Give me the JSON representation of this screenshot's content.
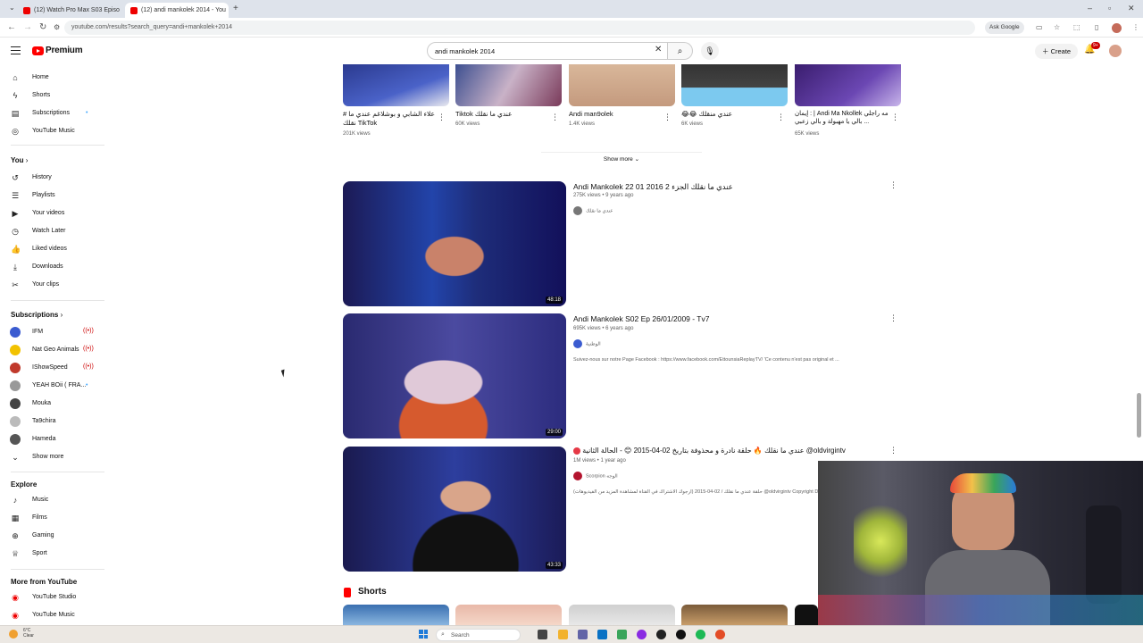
{
  "browser": {
    "tabs": [
      {
        "title": "(12) Watch Pro Max S03 Episo"
      },
      {
        "title": "(12) andi mankolek 2014 - You"
      }
    ],
    "url": "youtube.com/results?search_query=andi+mankolek+2014",
    "ask_google": "Ask Google"
  },
  "header": {
    "logo": "Premium",
    "search_value": "andi mankolek 2014",
    "create_label": "Create",
    "notif_count": "9+"
  },
  "sidebar": {
    "main": [
      {
        "label": "Home",
        "icon": "home-icon"
      },
      {
        "label": "Shorts",
        "icon": "shorts-icon"
      },
      {
        "label": "Subscriptions",
        "icon": "subscriptions-icon"
      },
      {
        "label": "YouTube Music",
        "icon": "music-icon"
      }
    ],
    "you_label": "You",
    "you": [
      {
        "label": "History"
      },
      {
        "label": "Playlists"
      },
      {
        "label": "Your videos"
      },
      {
        "label": "Watch Later"
      },
      {
        "label": "Liked videos"
      },
      {
        "label": "Downloads"
      },
      {
        "label": "Your clips"
      }
    ],
    "subs_label": "Subscriptions",
    "subs": [
      {
        "label": "IFM",
        "color": "#3a5bd0",
        "state": "live"
      },
      {
        "label": "Nat Geo Animals",
        "color": "#f2c200",
        "state": "live"
      },
      {
        "label": "IShowSpeed",
        "color": "#c0392b",
        "state": "live"
      },
      {
        "label": "YEAH BOii ( FRA...",
        "color": "#999999",
        "state": "dot"
      },
      {
        "label": "Mouka",
        "color": "#444444",
        "state": ""
      },
      {
        "label": "Ta9chira",
        "color": "#bbbbbb",
        "state": ""
      },
      {
        "label": "Hameda",
        "color": "#555555",
        "state": ""
      }
    ],
    "show_more": "Show more",
    "explore_label": "Explore",
    "explore": [
      {
        "label": "Music"
      },
      {
        "label": "Films"
      },
      {
        "label": "Gaming"
      },
      {
        "label": "Sport"
      }
    ],
    "more_label": "More from YouTube",
    "more": [
      {
        "label": "YouTube Studio"
      },
      {
        "label": "YouTube Music"
      }
    ]
  },
  "top_row": [
    {
      "title": "# علاء الشابي و بوشلاغم عندي ما نقلك TikTok",
      "views": "201K views"
    },
    {
      "title": "Tiktok عندي ما نقلك",
      "views": "60K views"
    },
    {
      "title": "Andi man9olek",
      "views": "1.4K views"
    },
    {
      "title": "😂😂 عندي منقلك",
      "views": "6K views"
    },
    {
      "title": "إيمان : | Andi Ma Nkollek مه راجلي بالي يا مهبولة و بالي زعبي ...",
      "views": "65K views"
    }
  ],
  "show_more_results": "Show more",
  "videos": [
    {
      "title": "Andi Mankolek 22 01 2016 عندي ما نقلك الجزء 2",
      "meta": "275K views • 9 years ago",
      "channel": "عندي ما نقلك",
      "desc": "",
      "duration": "48:18"
    },
    {
      "title": "Andi Mankolek S02 Ep 26/01/2009 - Tv7",
      "meta": "695K views • 6 years ago",
      "channel": "الوطنية",
      "desc": "Suivez-nous sur notre Page Facebook : https://www.facebook.com/EttounsiaReplayTV/ 'Ce contenu n'est pas original et ...",
      "duration": "29:00"
    },
    {
      "title": "عندي ما نقلك 🔥 حلقة نادرة و محذوفة بتاريخ 02-04-2015 😊 - الحالة الثانية",
      "channel_tag": "@oldvirgintv",
      "meta": "1M views • 1 year ago",
      "channel": "Scorpion الوجه",
      "desc": "حلقة عندي ما نقلك / 02-04-2015 (ارجوك الاشتراك في القناة لمشاهدة المزيد من الفيديوهات) @oldvirgintv Copyright Disclaimer Un...",
      "duration": "43:33"
    }
  ],
  "shorts_label": "Shorts",
  "taskbar": {
    "temp": "6°C",
    "weather": "Clear",
    "search": "Search"
  }
}
